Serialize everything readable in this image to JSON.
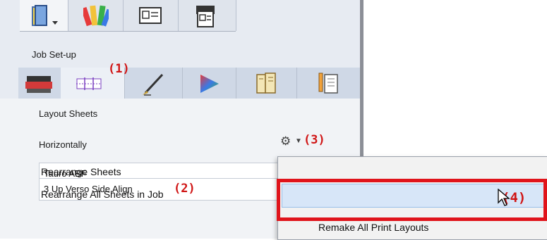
{
  "panel": {
    "section_label": "Job Set-up",
    "top_tabs": [
      {
        "icon": "book-icon",
        "active": true
      },
      {
        "icon": "color-swatches-icon",
        "active": false
      },
      {
        "icon": "id-card-icon",
        "active": false
      },
      {
        "icon": "printer-document-icon",
        "active": false
      }
    ],
    "icon_tabs": [
      {
        "icon": "printer-icon",
        "active": false
      },
      {
        "icon": "layout-grid-icon",
        "active": true
      },
      {
        "icon": "pen-icon",
        "active": false
      },
      {
        "icon": "color-triangle-icon",
        "active": false
      },
      {
        "icon": "binder-icon",
        "active": false
      },
      {
        "icon": "pencil-document-icon",
        "active": false
      }
    ]
  },
  "content": {
    "heading": "Layout Sheets",
    "orientation_label": "Horizontally",
    "sheet_field": "Tauro ABF",
    "layout_field": "3 Up Verso Side Align"
  },
  "menu": {
    "items": [
      "Rearrange Sheets",
      "Rearrange All Sheets in Job",
      "Remake All Print Layouts"
    ]
  },
  "annotations": {
    "a1": "(1)",
    "a2": "(2)",
    "a3": "(3)",
    "a4": "(4)"
  },
  "colors": {
    "annotation_red": "#e0141b",
    "menu_highlight": "#d7e6f8"
  }
}
